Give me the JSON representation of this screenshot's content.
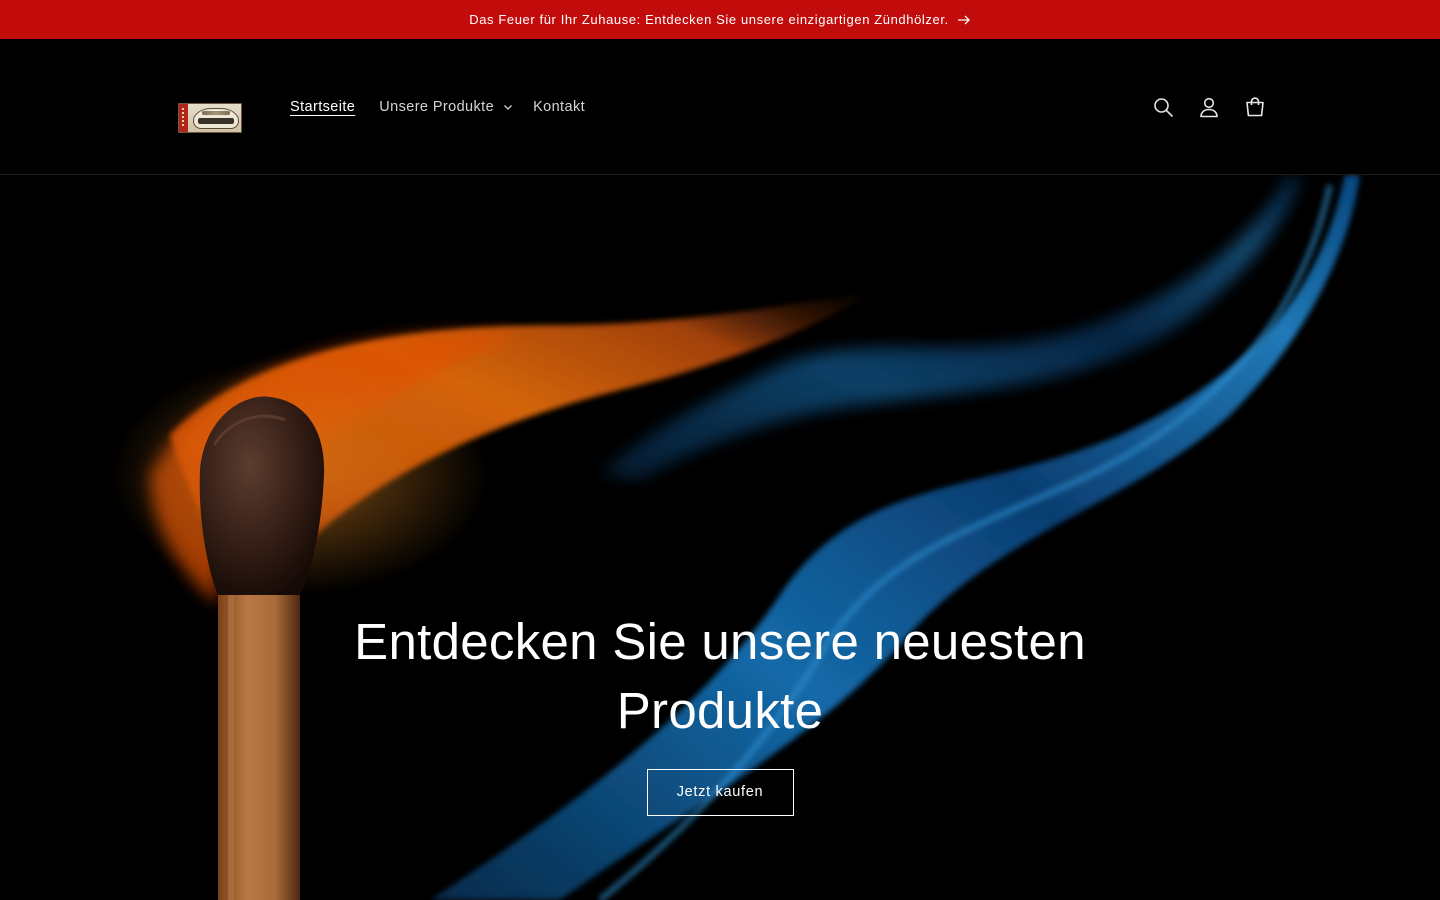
{
  "announcement": {
    "text": "Das Feuer für Ihr Zuhause: Entdecken Sie unsere einzigartigen Zündhölzer.",
    "icon": "arrow-right-icon",
    "background": "#c20c0c"
  },
  "header": {
    "logo_icon": "frutigen-matchbox-logo",
    "nav": [
      {
        "label": "Startseite",
        "active": true
      },
      {
        "label": "Unsere Produkte",
        "has_dropdown": true
      },
      {
        "label": "Kontakt"
      }
    ],
    "icons": [
      "search-icon",
      "account-icon",
      "cart-icon"
    ]
  },
  "hero": {
    "title": "Entdecken Sie unsere neuesten Produkte",
    "button_label": "Jetzt kaufen",
    "image": "burning-match-flame"
  },
  "colors": {
    "page_background": "#000000",
    "accent_red": "#c20c0c",
    "flame_orange": "#ff6a00",
    "flame_blue": "#1e8fe0"
  }
}
